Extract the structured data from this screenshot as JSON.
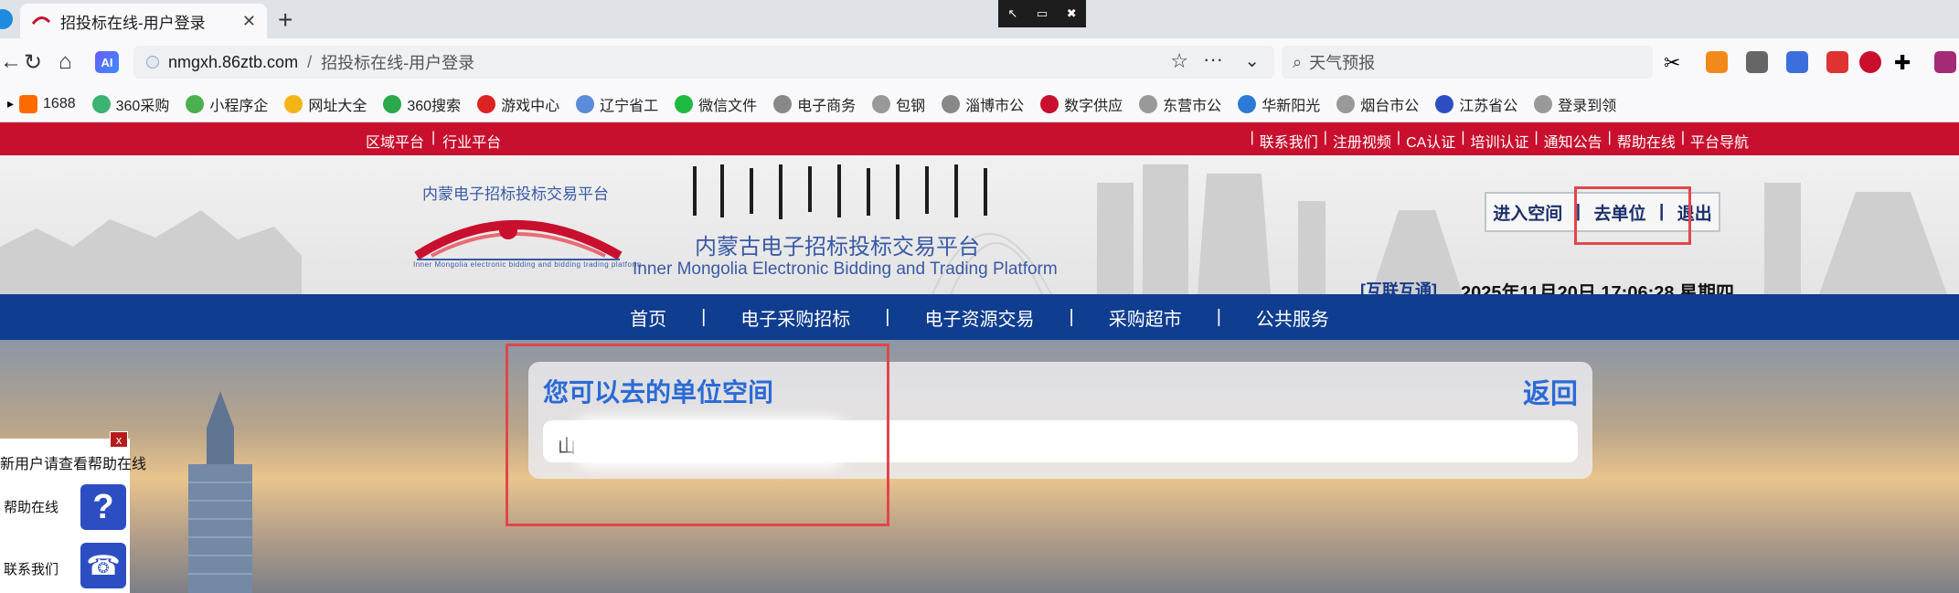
{
  "browser": {
    "tab_title": "招投标在线-用户登录",
    "new_tab": "+",
    "url_host": "nmgxh.86ztb.com",
    "url_sep": "/",
    "url_path": "招投标在线-用户登录",
    "search_placeholder": "天气预报",
    "ai_label": "AI",
    "bookmarks": [
      "1688",
      "360采购",
      "小程序企",
      "网址大全",
      "360搜索",
      "游戏中心",
      "辽宁省工",
      "微信文件",
      "电子商务",
      "包钢",
      "淄博市公",
      "数字供应",
      "东营市公",
      "华新阳光",
      "烟台市公",
      "江苏省公",
      "登录到领"
    ]
  },
  "site": {
    "topbar_left": [
      "区域平台",
      "|",
      "行业平台"
    ],
    "topbar_right": [
      "|",
      "联系我们",
      "|",
      "注册视频",
      "|",
      "CA认证",
      "|",
      "培训认证",
      "|",
      "通知公告",
      "|",
      "帮助在线",
      "|",
      "平台导航"
    ],
    "logo_top_text": "内蒙电子招标投标交易平台",
    "logo_caption": "Inner Mongolia electronic bidding and bidding trading platform",
    "name_cn": "内蒙古电子招标投标交易平台",
    "name_en": "Inner Mongolia Electronic Bidding and Trading Platform",
    "user_links": {
      "enter_space": "进入空间",
      "sep1": "|",
      "go_unit": "去单位",
      "sep2": "|",
      "logout": "退出"
    },
    "huli": "[互联互通]",
    "datetime": "2025年11月20日 17:06:28 星期四",
    "menu": [
      "首页",
      "电子采购招标",
      "电子资源交易",
      "采购超市",
      "公共服务"
    ],
    "menu_sep": "|",
    "card": {
      "title": "您可以去的单位空间",
      "back": "返回",
      "item": "山"
    },
    "help": {
      "close": "x",
      "notice": "新用户请查看帮助在线",
      "help_label": "帮助在线",
      "contact_label": "联系我们",
      "q": "?"
    }
  },
  "colors": {
    "red": "#c8102e",
    "blue": "#0f3d8f",
    "accent": "#2a6bd6",
    "mark": "#e0474c"
  }
}
